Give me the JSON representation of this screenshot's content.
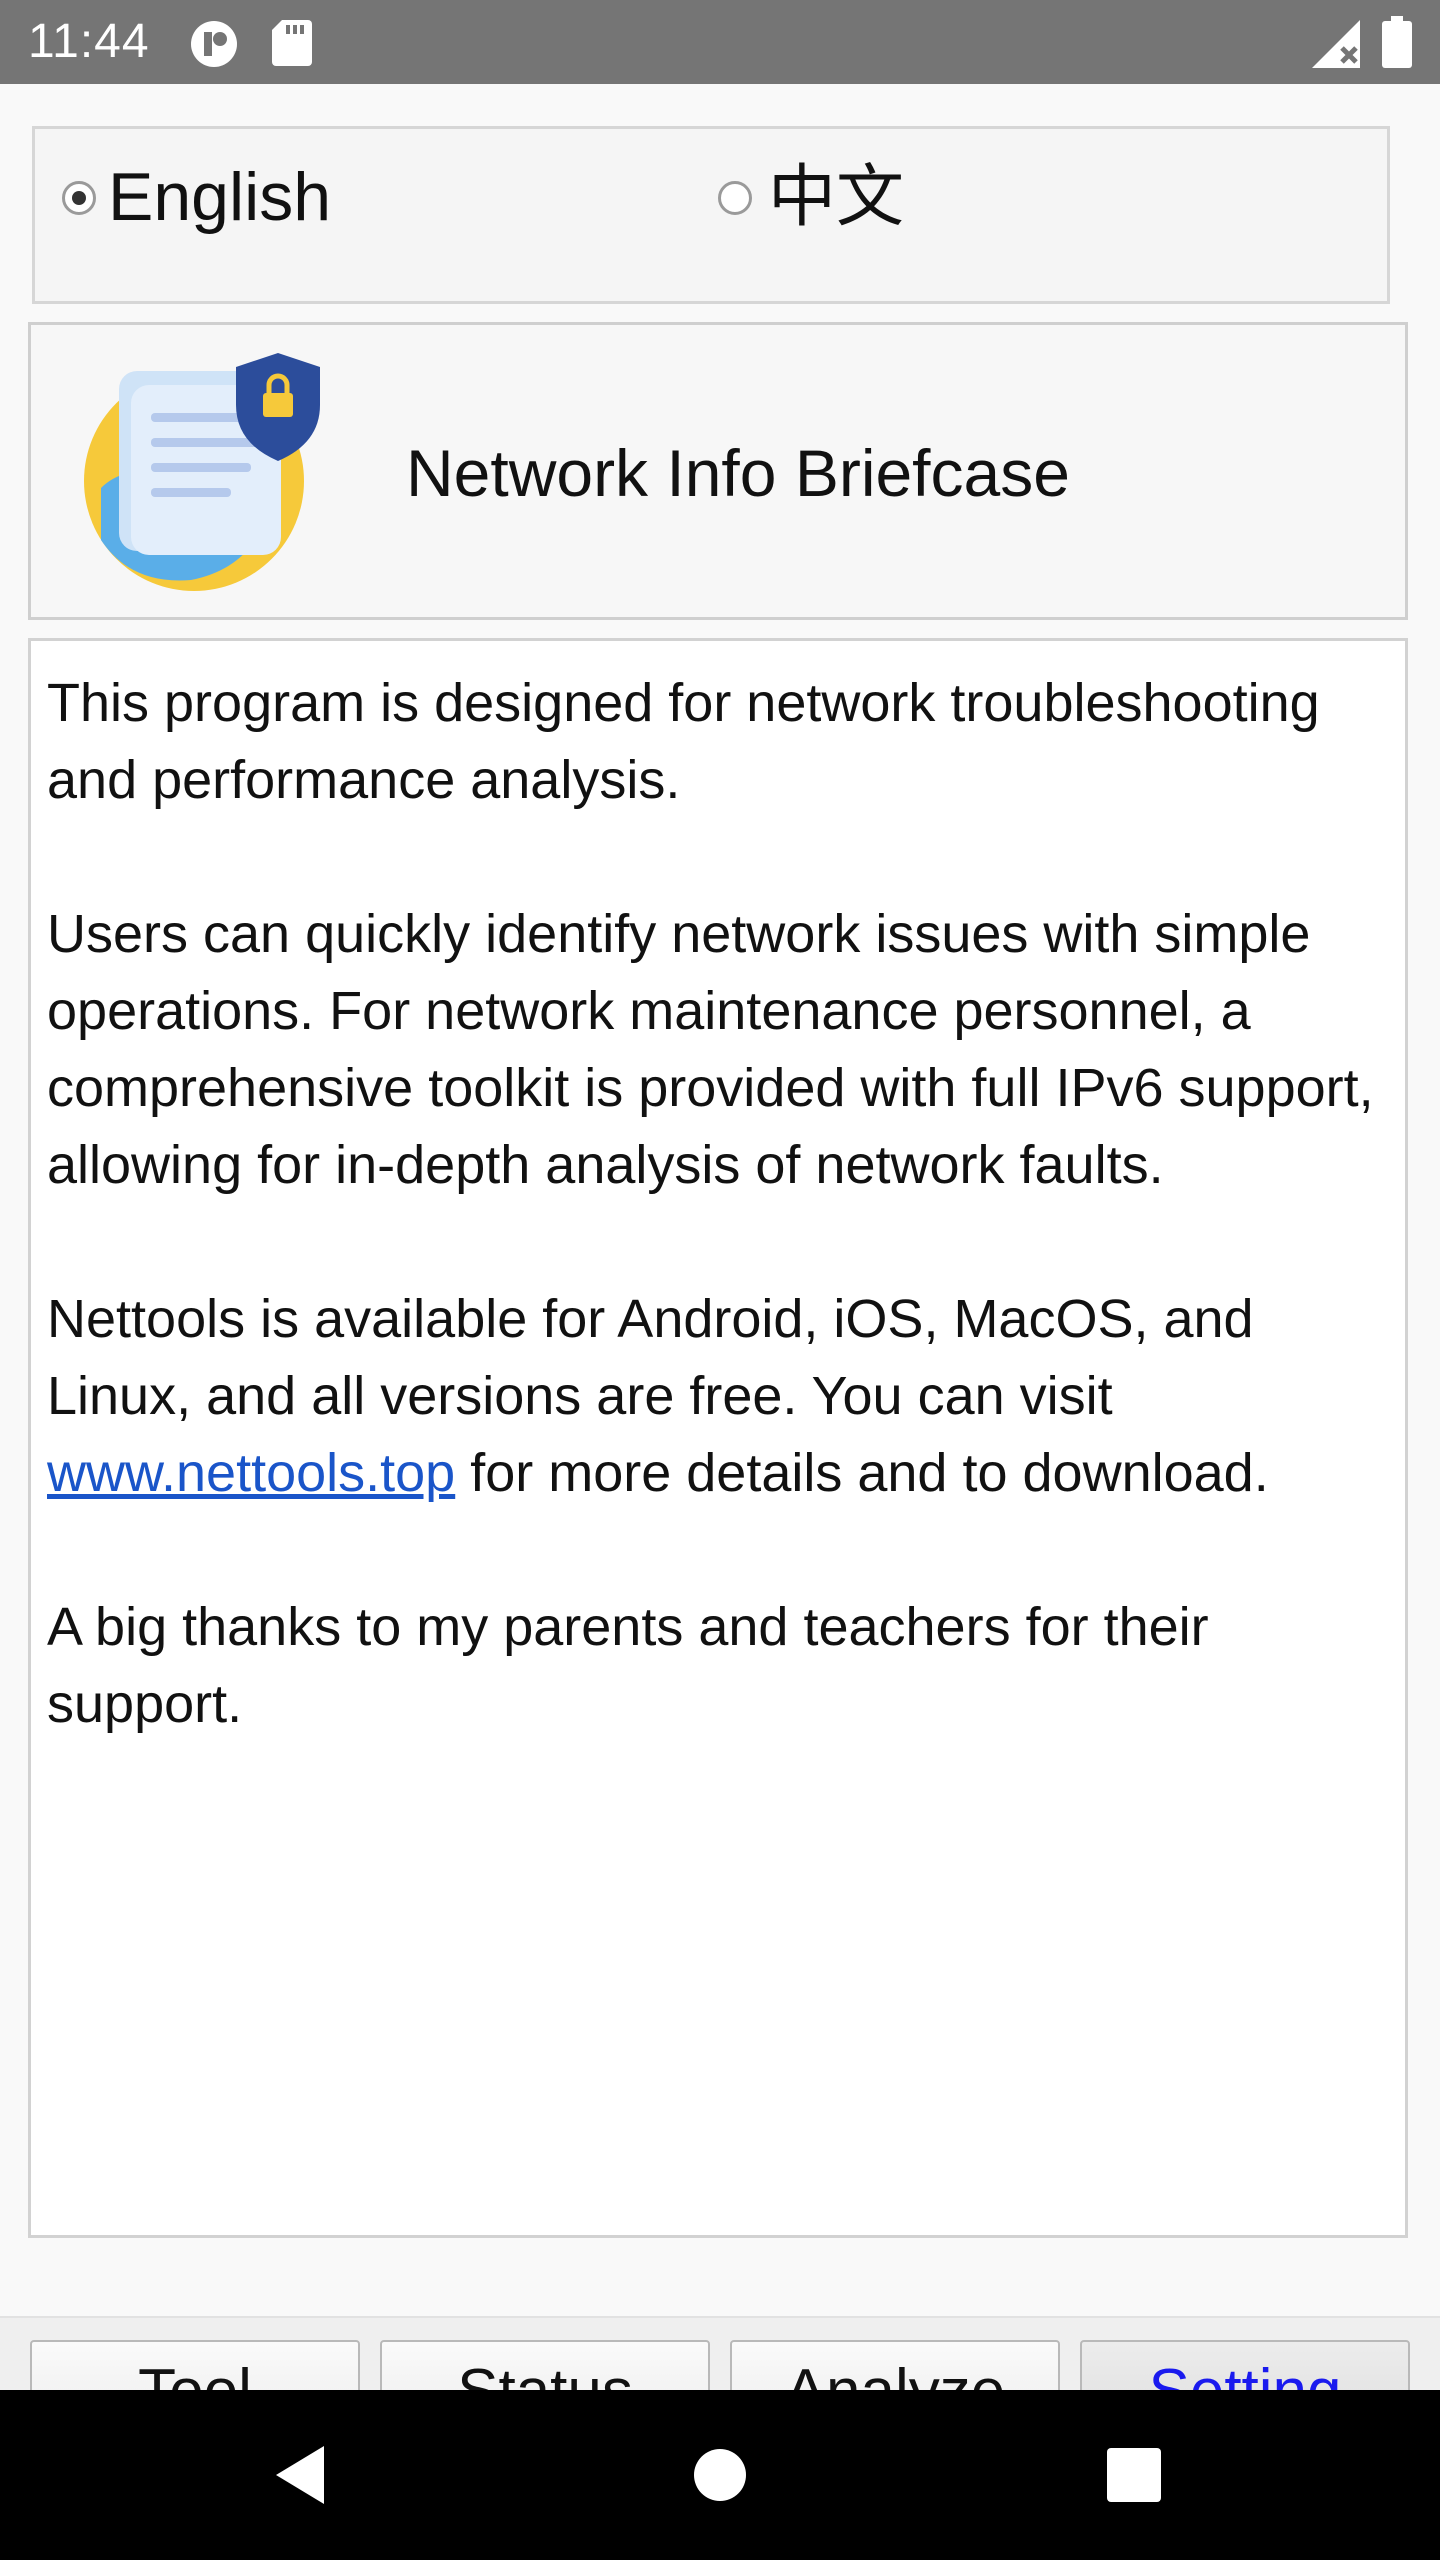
{
  "status_bar": {
    "time": "11:44",
    "icons": [
      "app-status-icon",
      "sd-card-icon",
      "signal-off-icon",
      "battery-icon"
    ]
  },
  "language": {
    "options": [
      {
        "label": "English",
        "selected": true
      },
      {
        "label": "中文",
        "selected": false
      }
    ]
  },
  "header": {
    "title": "Network Info Briefcase",
    "logo_icon": "document-shield-logo-icon"
  },
  "description": {
    "para1": "This program is designed for network troubleshooting and performance analysis.",
    "para2": "Users can quickly identify network issues with simple operations. For network maintenance personnel, a comprehensive toolkit is provided with full IPv6 support, allowing for in-depth analysis of network faults.",
    "para3_before": "Nettools is available for Android, iOS, MacOS, and Linux, and all versions are free. You can visit ",
    "para3_link": "www.nettools.top",
    "para3_after": " for more details and to download.",
    "para4": "A big thanks to my parents and teachers for their support."
  },
  "tabs": {
    "tool": "Tool",
    "status": "Status",
    "analyze": "Analyze",
    "setting": "Setting",
    "active": "Setting"
  },
  "nav": {
    "icons": [
      "back-icon",
      "home-icon",
      "recents-icon"
    ]
  },
  "colors": {
    "status_bar": "#757575",
    "link": "#1a55c9",
    "active_tab_text": "#1a1aee"
  }
}
